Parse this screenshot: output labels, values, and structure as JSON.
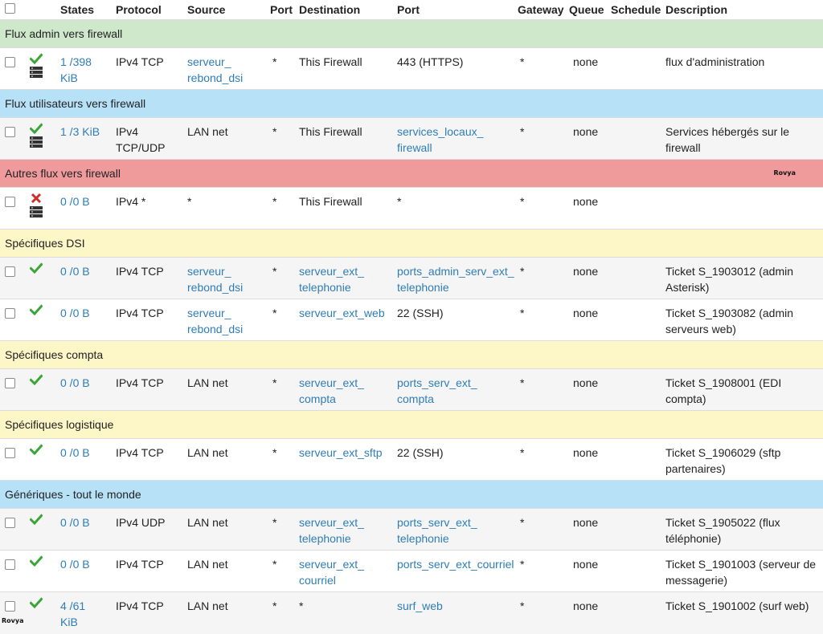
{
  "headers": {
    "select_all": "",
    "states": "States",
    "protocol": "Protocol",
    "source": "Source",
    "src_port": "Port",
    "destination": "Destination",
    "dst_port": "Port",
    "gateway": "Gateway",
    "queue": "Queue",
    "schedule": "Schedule",
    "description": "Description"
  },
  "logo_text": "Rovya",
  "sections": [
    {
      "title": "Flux admin vers firewall",
      "color": "green",
      "logo": false,
      "rules": [
        {
          "status": "pass",
          "server": true,
          "states": [
            "1 /398",
            "KiB"
          ],
          "protocol": [
            "IPv4 TCP"
          ],
          "source": [
            "serveur_",
            "rebond_dsi"
          ],
          "source_link": true,
          "src_port": "*",
          "destination": [
            "This Firewall"
          ],
          "dest_link": false,
          "dst_port": [
            "443 (HTTPS)"
          ],
          "dst_port_link": false,
          "gateway": "*",
          "queue": "none",
          "schedule": "",
          "description": [
            "flux d'administration"
          ]
        }
      ]
    },
    {
      "title": "Flux utilisateurs vers firewall",
      "color": "blue",
      "logo": false,
      "rules": [
        {
          "status": "pass",
          "server": true,
          "states": [
            "1 /3 KiB"
          ],
          "protocol": [
            "IPv4",
            "TCP/UDP"
          ],
          "source": [
            "LAN net"
          ],
          "source_link": false,
          "src_port": "*",
          "destination": [
            "This Firewall"
          ],
          "dest_link": false,
          "dst_port": [
            "services_locaux_",
            "firewall"
          ],
          "dst_port_link": true,
          "gateway": "*",
          "queue": "none",
          "schedule": "",
          "description": [
            "Services hébergés sur le",
            "firewall"
          ]
        }
      ]
    },
    {
      "title": "Autres flux vers firewall",
      "color": "red",
      "logo": true,
      "rules": [
        {
          "status": "block",
          "server": true,
          "states": [
            "0 /0 B"
          ],
          "protocol": [
            "IPv4 *"
          ],
          "source": [
            "*"
          ],
          "source_link": false,
          "src_port": "*",
          "destination": [
            "This Firewall"
          ],
          "dest_link": false,
          "dst_port": [
            "*"
          ],
          "dst_port_link": false,
          "gateway": "*",
          "queue": "none",
          "schedule": "",
          "description": [
            ""
          ]
        }
      ]
    },
    {
      "title": "Spécifiques DSI",
      "color": "yellow",
      "logo": false,
      "rules": [
        {
          "status": "pass",
          "server": false,
          "states": [
            "0 /0 B"
          ],
          "protocol": [
            "IPv4 TCP"
          ],
          "source": [
            "serveur_",
            "rebond_dsi"
          ],
          "source_link": true,
          "src_port": "*",
          "destination": [
            "serveur_ext_",
            "telephonie"
          ],
          "dest_link": true,
          "dst_port": [
            "ports_admin_serv_ext_",
            "telephonie"
          ],
          "dst_port_link": true,
          "gateway": "*",
          "queue": "none",
          "schedule": "",
          "description": [
            "Ticket S_1903012 (admin",
            "Asterisk)"
          ]
        },
        {
          "status": "pass",
          "server": false,
          "states": [
            "0 /0 B"
          ],
          "protocol": [
            "IPv4 TCP"
          ],
          "source": [
            "serveur_",
            "rebond_dsi"
          ],
          "source_link": true,
          "src_port": "*",
          "destination": [
            "serveur_ext_web"
          ],
          "dest_link": true,
          "dst_port": [
            "22 (SSH)"
          ],
          "dst_port_link": false,
          "gateway": "*",
          "queue": "none",
          "schedule": "",
          "description": [
            "Ticket S_1903082 (admin",
            "serveurs web)"
          ]
        }
      ]
    },
    {
      "title": "Spécifiques compta",
      "color": "yellow",
      "logo": false,
      "rules": [
        {
          "status": "pass",
          "server": false,
          "states": [
            "0 /0 B"
          ],
          "protocol": [
            "IPv4 TCP"
          ],
          "source": [
            "LAN net"
          ],
          "source_link": false,
          "src_port": "*",
          "destination": [
            "serveur_ext_",
            "compta"
          ],
          "dest_link": true,
          "dst_port": [
            "ports_serv_ext_",
            "compta"
          ],
          "dst_port_link": true,
          "gateway": "*",
          "queue": "none",
          "schedule": "",
          "description": [
            "Ticket S_1908001 (EDI",
            "compta)"
          ]
        }
      ]
    },
    {
      "title": "Spécifiques logistique",
      "color": "yellow",
      "logo": false,
      "rules": [
        {
          "status": "pass",
          "server": false,
          "states": [
            "0 /0 B"
          ],
          "protocol": [
            "IPv4 TCP"
          ],
          "source": [
            "LAN net"
          ],
          "source_link": false,
          "src_port": "*",
          "destination": [
            "serveur_ext_sftp"
          ],
          "dest_link": true,
          "dst_port": [
            "22 (SSH)"
          ],
          "dst_port_link": false,
          "gateway": "*",
          "queue": "none",
          "schedule": "",
          "description": [
            "Ticket S_1906029 (sftp",
            "partenaires)"
          ]
        }
      ]
    },
    {
      "title": "Génériques - tout le monde",
      "color": "blue",
      "logo": false,
      "rules": [
        {
          "status": "pass",
          "server": false,
          "states": [
            "0 /0 B"
          ],
          "protocol": [
            "IPv4 UDP"
          ],
          "source": [
            "LAN net"
          ],
          "source_link": false,
          "src_port": "*",
          "destination": [
            "serveur_ext_",
            "telephonie"
          ],
          "dest_link": true,
          "dst_port": [
            "ports_serv_ext_",
            "telephonie"
          ],
          "dst_port_link": true,
          "gateway": "*",
          "queue": "none",
          "schedule": "",
          "description": [
            "Ticket S_1905022 (flux",
            "téléphonie)"
          ]
        },
        {
          "status": "pass",
          "server": false,
          "states": [
            "0 /0 B"
          ],
          "protocol": [
            "IPv4 TCP"
          ],
          "source": [
            "LAN net"
          ],
          "source_link": false,
          "src_port": "*",
          "destination": [
            "serveur_ext_",
            "courriel"
          ],
          "dest_link": true,
          "dst_port": [
            "ports_serv_ext_courriel"
          ],
          "dst_port_link": true,
          "gateway": "*",
          "queue": "none",
          "schedule": "",
          "description": [
            "Ticket S_1901003 (serveur de",
            "messagerie)"
          ]
        },
        {
          "status": "pass",
          "server": false,
          "logo": true,
          "states": [
            "4 /61",
            "KiB"
          ],
          "protocol": [
            "IPv4 TCP"
          ],
          "source": [
            "LAN net"
          ],
          "source_link": false,
          "src_port": "*",
          "destination": [
            "*"
          ],
          "dest_link": false,
          "dst_port": [
            "surf_web"
          ],
          "dst_port_link": true,
          "gateway": "*",
          "queue": "none",
          "schedule": "",
          "description": [
            "Ticket S_1901002 (surf web)"
          ]
        }
      ]
    }
  ],
  "colors": {
    "green": "#cfe8cc",
    "blue": "#b7e1f7",
    "red": "#f09b9b",
    "yellow": "#fdf6c7",
    "pass": "#3aa637",
    "block": "#c9302c",
    "link": "#2f7db6"
  }
}
